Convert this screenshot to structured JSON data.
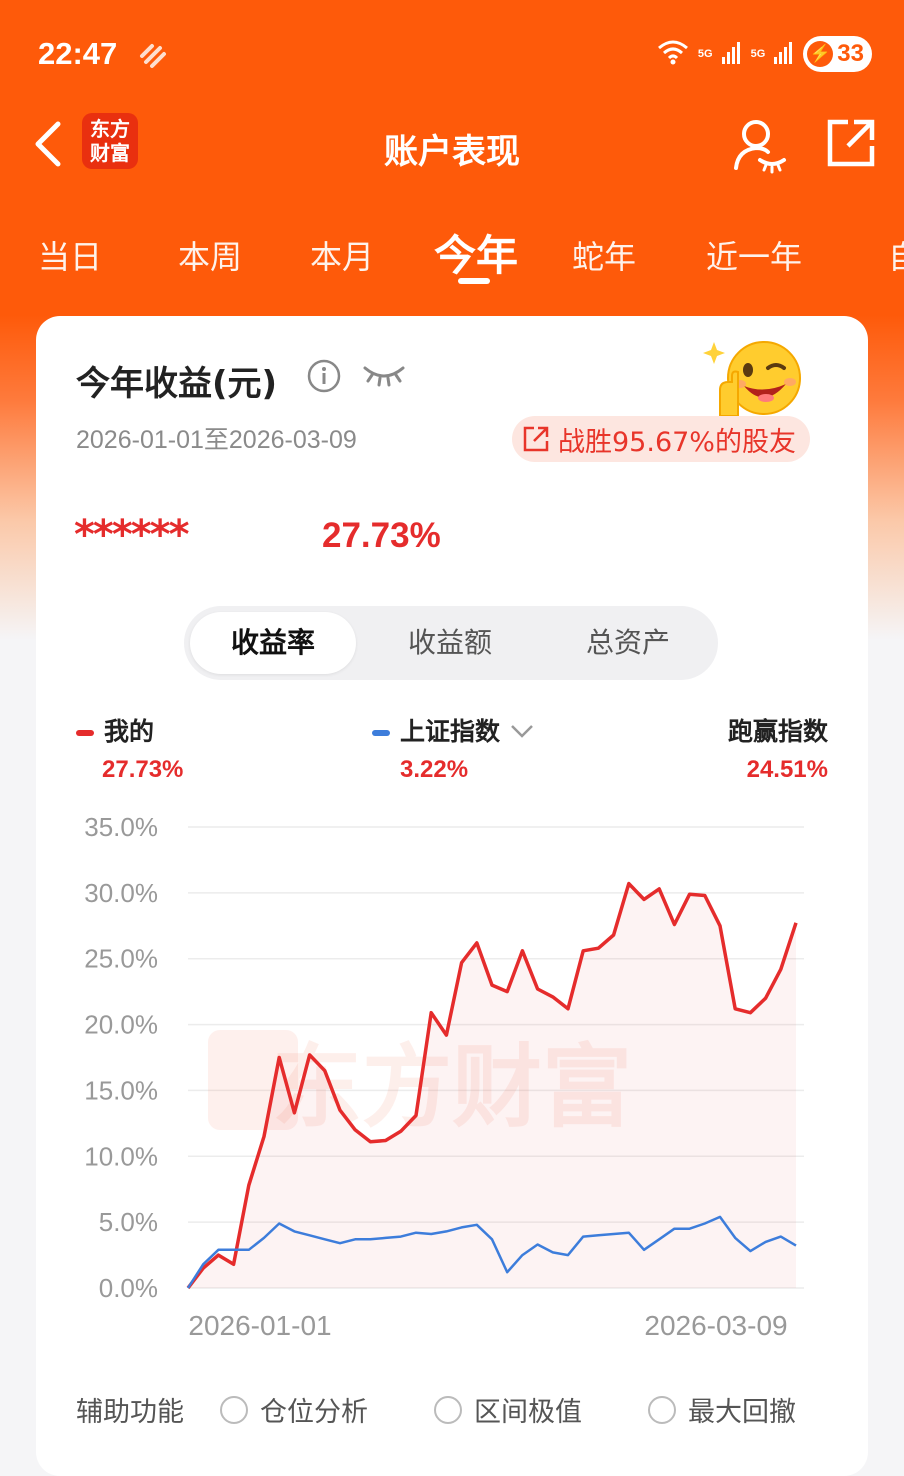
{
  "status_bar": {
    "time": "22:47",
    "net1": "5G",
    "net2": "5G",
    "battery": "33"
  },
  "nav": {
    "logo_line1": "东方",
    "logo_line2": "财富",
    "title": "账户表现"
  },
  "tabs": [
    "当日",
    "本周",
    "本月",
    "今年",
    "蛇年",
    "近一年",
    "自"
  ],
  "active_tab": "今年",
  "card": {
    "title": "今年收益(元)",
    "date_range": "2026-01-01至2026-03-09",
    "beat_text": "战胜95.67%的股友",
    "amount_hidden": "******",
    "return_rate": "27.73%"
  },
  "segments": [
    "收益率",
    "收益额",
    "总资产"
  ],
  "active_segment": "收益率",
  "legend": {
    "mine_label": "我的",
    "mine_value": "27.73%",
    "index_label": "上证指数",
    "index_value": "3.22%",
    "beat_label": "跑赢指数",
    "beat_value": "24.51%"
  },
  "colors": {
    "accent": "#fe5a0a",
    "mine": "#e52c2c",
    "index": "#3d7ddb"
  },
  "chart_data": {
    "type": "line",
    "watermark": "东方财富",
    "y_ticks": [
      "35.0%",
      "30.0%",
      "25.0%",
      "20.0%",
      "15.0%",
      "10.0%",
      "5.0%",
      "0.0%"
    ],
    "ylim": [
      0,
      35
    ],
    "x_ticks": [
      "2026-01-01",
      "2026-03-09"
    ],
    "series": [
      {
        "name": "我的",
        "color": "#e52c2c",
        "values": [
          0.0,
          1.5,
          2.5,
          1.8,
          7.8,
          11.5,
          17.5,
          13.3,
          17.7,
          16.5,
          13.5,
          12.0,
          11.1,
          11.2,
          11.9,
          13.1,
          20.9,
          19.2,
          24.7,
          26.2,
          23.0,
          22.5,
          25.6,
          22.7,
          22.1,
          21.2,
          25.6,
          25.8,
          26.8,
          30.7,
          29.5,
          30.3,
          27.6,
          29.9,
          29.8,
          27.5,
          21.2,
          20.9,
          22.0,
          24.2,
          27.73
        ]
      },
      {
        "name": "上证指数",
        "color": "#3d7ddb",
        "values": [
          0.0,
          1.8,
          2.9,
          2.9,
          2.9,
          3.8,
          4.9,
          4.3,
          4.0,
          3.7,
          3.4,
          3.7,
          3.7,
          3.8,
          3.9,
          4.2,
          4.1,
          4.3,
          4.6,
          4.8,
          3.7,
          1.2,
          2.5,
          3.3,
          2.7,
          2.5,
          3.9,
          4.0,
          4.1,
          4.2,
          2.9,
          3.7,
          4.5,
          4.5,
          4.9,
          5.4,
          3.8,
          2.8,
          3.5,
          3.9,
          3.22
        ]
      }
    ]
  },
  "aux": {
    "label": "辅助功能",
    "options": [
      "仓位分析",
      "区间极值",
      "最大回撤"
    ]
  }
}
